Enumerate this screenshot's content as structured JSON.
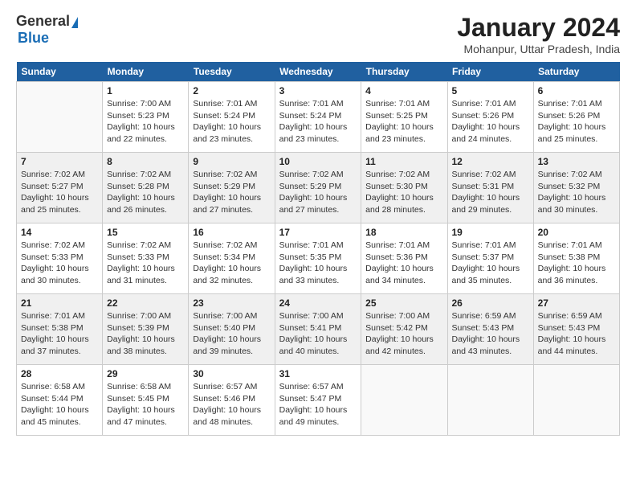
{
  "header": {
    "logo_general": "General",
    "logo_blue": "Blue",
    "month_title": "January 2024",
    "location": "Mohanpur, Uttar Pradesh, India"
  },
  "days_of_week": [
    "Sunday",
    "Monday",
    "Tuesday",
    "Wednesday",
    "Thursday",
    "Friday",
    "Saturday"
  ],
  "weeks": [
    [
      {
        "day": "",
        "info": ""
      },
      {
        "day": "1",
        "info": "Sunrise: 7:00 AM\nSunset: 5:23 PM\nDaylight: 10 hours\nand 22 minutes."
      },
      {
        "day": "2",
        "info": "Sunrise: 7:01 AM\nSunset: 5:24 PM\nDaylight: 10 hours\nand 23 minutes."
      },
      {
        "day": "3",
        "info": "Sunrise: 7:01 AM\nSunset: 5:24 PM\nDaylight: 10 hours\nand 23 minutes."
      },
      {
        "day": "4",
        "info": "Sunrise: 7:01 AM\nSunset: 5:25 PM\nDaylight: 10 hours\nand 23 minutes."
      },
      {
        "day": "5",
        "info": "Sunrise: 7:01 AM\nSunset: 5:26 PM\nDaylight: 10 hours\nand 24 minutes."
      },
      {
        "day": "6",
        "info": "Sunrise: 7:01 AM\nSunset: 5:26 PM\nDaylight: 10 hours\nand 25 minutes."
      }
    ],
    [
      {
        "day": "7",
        "info": "Sunrise: 7:02 AM\nSunset: 5:27 PM\nDaylight: 10 hours\nand 25 minutes."
      },
      {
        "day": "8",
        "info": "Sunrise: 7:02 AM\nSunset: 5:28 PM\nDaylight: 10 hours\nand 26 minutes."
      },
      {
        "day": "9",
        "info": "Sunrise: 7:02 AM\nSunset: 5:29 PM\nDaylight: 10 hours\nand 27 minutes."
      },
      {
        "day": "10",
        "info": "Sunrise: 7:02 AM\nSunset: 5:29 PM\nDaylight: 10 hours\nand 27 minutes."
      },
      {
        "day": "11",
        "info": "Sunrise: 7:02 AM\nSunset: 5:30 PM\nDaylight: 10 hours\nand 28 minutes."
      },
      {
        "day": "12",
        "info": "Sunrise: 7:02 AM\nSunset: 5:31 PM\nDaylight: 10 hours\nand 29 minutes."
      },
      {
        "day": "13",
        "info": "Sunrise: 7:02 AM\nSunset: 5:32 PM\nDaylight: 10 hours\nand 30 minutes."
      }
    ],
    [
      {
        "day": "14",
        "info": "Sunrise: 7:02 AM\nSunset: 5:33 PM\nDaylight: 10 hours\nand 30 minutes."
      },
      {
        "day": "15",
        "info": "Sunrise: 7:02 AM\nSunset: 5:33 PM\nDaylight: 10 hours\nand 31 minutes."
      },
      {
        "day": "16",
        "info": "Sunrise: 7:02 AM\nSunset: 5:34 PM\nDaylight: 10 hours\nand 32 minutes."
      },
      {
        "day": "17",
        "info": "Sunrise: 7:01 AM\nSunset: 5:35 PM\nDaylight: 10 hours\nand 33 minutes."
      },
      {
        "day": "18",
        "info": "Sunrise: 7:01 AM\nSunset: 5:36 PM\nDaylight: 10 hours\nand 34 minutes."
      },
      {
        "day": "19",
        "info": "Sunrise: 7:01 AM\nSunset: 5:37 PM\nDaylight: 10 hours\nand 35 minutes."
      },
      {
        "day": "20",
        "info": "Sunrise: 7:01 AM\nSunset: 5:38 PM\nDaylight: 10 hours\nand 36 minutes."
      }
    ],
    [
      {
        "day": "21",
        "info": "Sunrise: 7:01 AM\nSunset: 5:38 PM\nDaylight: 10 hours\nand 37 minutes."
      },
      {
        "day": "22",
        "info": "Sunrise: 7:00 AM\nSunset: 5:39 PM\nDaylight: 10 hours\nand 38 minutes."
      },
      {
        "day": "23",
        "info": "Sunrise: 7:00 AM\nSunset: 5:40 PM\nDaylight: 10 hours\nand 39 minutes."
      },
      {
        "day": "24",
        "info": "Sunrise: 7:00 AM\nSunset: 5:41 PM\nDaylight: 10 hours\nand 40 minutes."
      },
      {
        "day": "25",
        "info": "Sunrise: 7:00 AM\nSunset: 5:42 PM\nDaylight: 10 hours\nand 42 minutes."
      },
      {
        "day": "26",
        "info": "Sunrise: 6:59 AM\nSunset: 5:43 PM\nDaylight: 10 hours\nand 43 minutes."
      },
      {
        "day": "27",
        "info": "Sunrise: 6:59 AM\nSunset: 5:43 PM\nDaylight: 10 hours\nand 44 minutes."
      }
    ],
    [
      {
        "day": "28",
        "info": "Sunrise: 6:58 AM\nSunset: 5:44 PM\nDaylight: 10 hours\nand 45 minutes."
      },
      {
        "day": "29",
        "info": "Sunrise: 6:58 AM\nSunset: 5:45 PM\nDaylight: 10 hours\nand 47 minutes."
      },
      {
        "day": "30",
        "info": "Sunrise: 6:57 AM\nSunset: 5:46 PM\nDaylight: 10 hours\nand 48 minutes."
      },
      {
        "day": "31",
        "info": "Sunrise: 6:57 AM\nSunset: 5:47 PM\nDaylight: 10 hours\nand 49 minutes."
      },
      {
        "day": "",
        "info": ""
      },
      {
        "day": "",
        "info": ""
      },
      {
        "day": "",
        "info": ""
      }
    ]
  ]
}
